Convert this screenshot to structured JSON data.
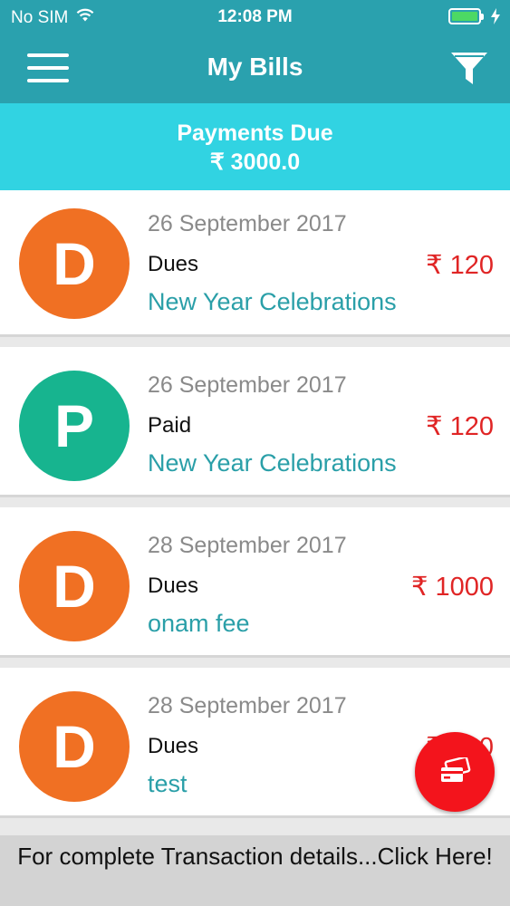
{
  "status_bar": {
    "carrier": "No SIM",
    "time": "12:08 PM",
    "battery_color": "#4cd964"
  },
  "header": {
    "title": "My Bills",
    "menu_icon": "hamburger-menu-icon",
    "filter_icon": "funnel-filter-icon",
    "color": "#2aa1ae"
  },
  "summary": {
    "label": "Payments Due",
    "amount": "₹ 3000.0",
    "color": "#31d3e2"
  },
  "bills": [
    {
      "initial": "D",
      "date": "26 September 2017",
      "status": "Dues",
      "event": "New Year Celebrations",
      "amount": "₹ 120",
      "avatar_color": "#f07023"
    },
    {
      "initial": "P",
      "date": "26 September 2017",
      "status": "Paid",
      "event": "New Year Celebrations",
      "amount": "₹ 120",
      "avatar_color": "#17b48f"
    },
    {
      "initial": "D",
      "date": "28 September 2017",
      "status": "Dues",
      "event": "onam fee",
      "amount": "₹ 1000",
      "avatar_color": "#f07023"
    },
    {
      "initial": "D",
      "date": "28 September 2017",
      "status": "Dues",
      "event": "test",
      "amount": "₹ 100",
      "avatar_color": "#f07023"
    }
  ],
  "fab": {
    "icon": "cards-payment-icon",
    "color": "#f3141c"
  },
  "footer": {
    "text": "For complete Transaction details...Click Here!"
  }
}
